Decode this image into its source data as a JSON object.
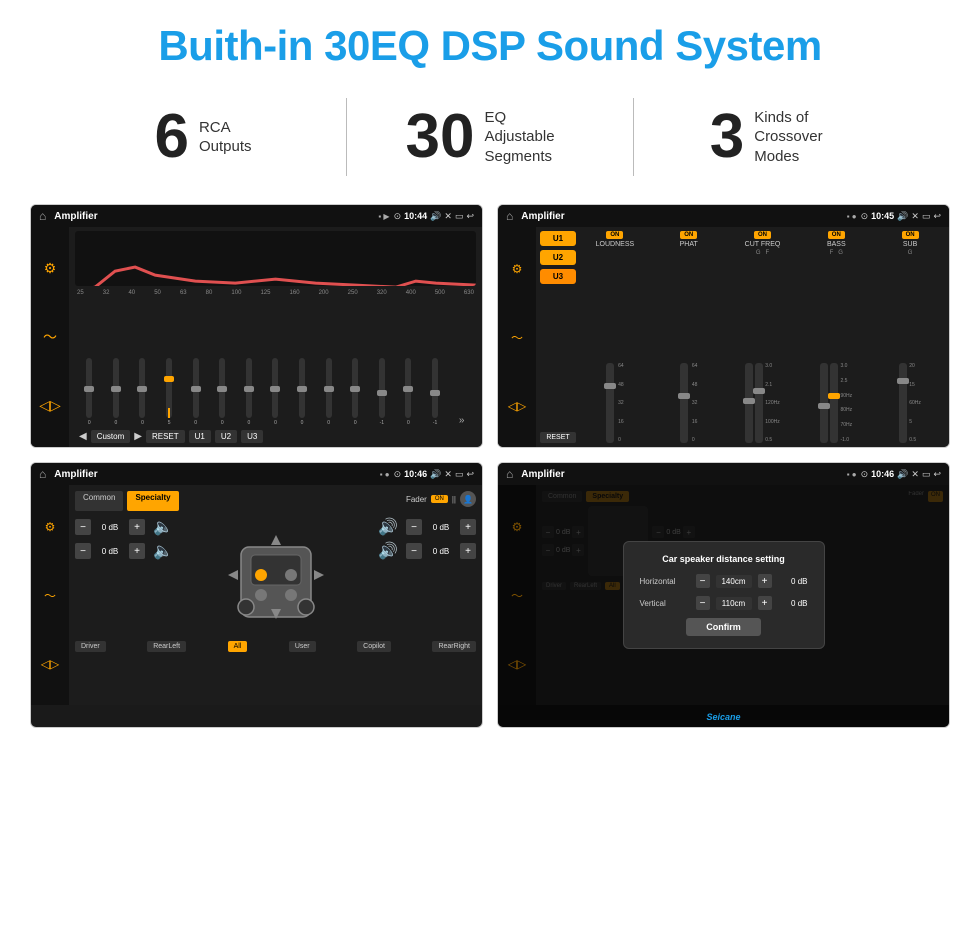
{
  "header": {
    "title": "Buith-in 30EQ DSP Sound System"
  },
  "stats": [
    {
      "number": "6",
      "label": "RCA\nOutputs"
    },
    {
      "number": "30",
      "label": "EQ Adjustable\nSegments"
    },
    {
      "number": "3",
      "label": "Kinds of\nCrossover Modes"
    }
  ],
  "screens": {
    "eq": {
      "title": "Amplifier",
      "time": "10:44",
      "freq_labels": [
        "25",
        "32",
        "40",
        "50",
        "63",
        "80",
        "100",
        "125",
        "160",
        "200",
        "250",
        "320",
        "400",
        "500",
        "630"
      ],
      "slider_values": [
        "0",
        "0",
        "0",
        "5",
        "0",
        "0",
        "0",
        "0",
        "0",
        "0",
        "0",
        "-1",
        "0",
        "-1"
      ],
      "controls": [
        "Custom",
        "RESET",
        "U1",
        "U2",
        "U3"
      ]
    },
    "crossover": {
      "title": "Amplifier",
      "time": "10:45",
      "channels": [
        "U1",
        "U2",
        "U3"
      ],
      "controls": [
        "LOUDNESS",
        "PHAT",
        "CUT FREQ",
        "BASS",
        "SUB"
      ],
      "values": [
        "64",
        "48",
        "32",
        "16"
      ]
    },
    "fader": {
      "title": "Amplifier",
      "time": "10:46",
      "tabs": [
        "Common",
        "Specialty"
      ],
      "fader_label": "Fader",
      "fader_on": "ON",
      "controls": [
        {
          "label": "- 0 dB +",
          "val": "0 dB"
        },
        {
          "label": "- 0 dB +",
          "val": "0 dB"
        },
        {
          "label": "- 0 dB +",
          "val": "0 dB"
        },
        {
          "label": "- 0 dB +",
          "val": "0 dB"
        }
      ],
      "bottom_btns": [
        "Driver",
        "RearLeft",
        "All",
        "User",
        "Copilot",
        "RearRight"
      ]
    },
    "dialog": {
      "title": "Amplifier",
      "time": "10:46",
      "dialog_title": "Car speaker distance setting",
      "fields": [
        {
          "label": "Horizontal",
          "value": "140cm"
        },
        {
          "label": "Vertical",
          "value": "110cm"
        }
      ],
      "db_values": [
        "0 dB",
        "0 dB"
      ],
      "confirm_label": "Confirm"
    }
  },
  "watermark": "Seicane"
}
